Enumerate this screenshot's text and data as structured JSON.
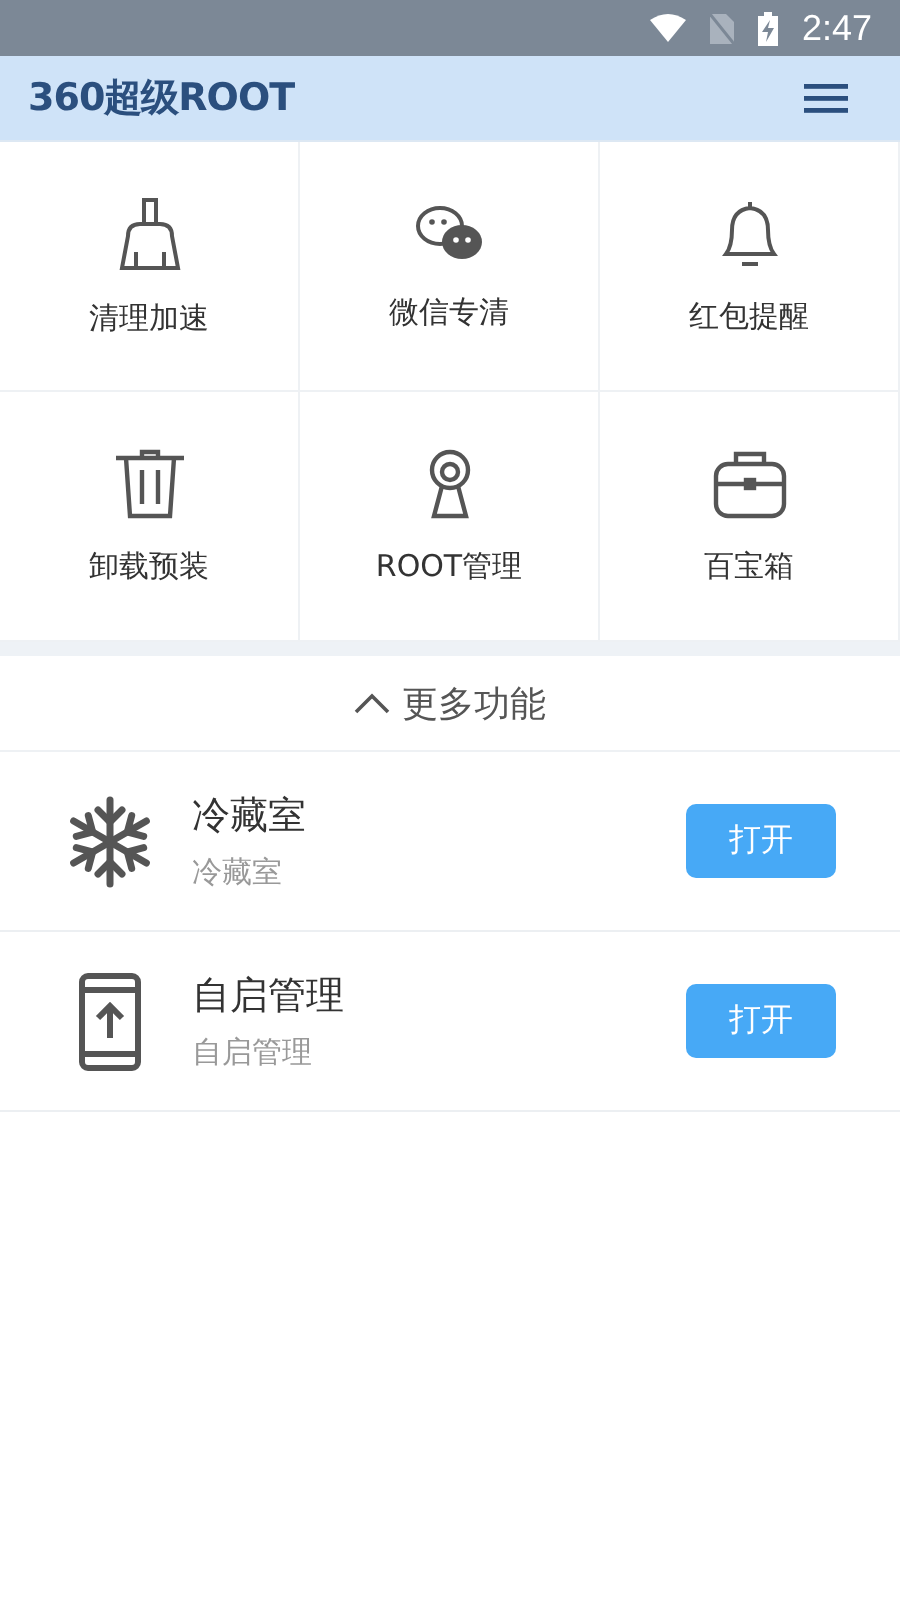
{
  "status_bar": {
    "time": "2:47"
  },
  "app_bar": {
    "title": "360超级ROOT"
  },
  "tools": [
    {
      "label": "清理加速"
    },
    {
      "label": "微信专清"
    },
    {
      "label": "红包提醒"
    },
    {
      "label": "卸载预装"
    },
    {
      "label": "ROOT管理"
    },
    {
      "label": "百宝箱"
    }
  ],
  "more_toggle": {
    "label": "更多功能",
    "expanded": true
  },
  "features": [
    {
      "title": "冷藏室",
      "subtitle": "冷藏室",
      "button": "打开"
    },
    {
      "title": "自启管理",
      "subtitle": "自启管理",
      "button": "打开"
    }
  ]
}
